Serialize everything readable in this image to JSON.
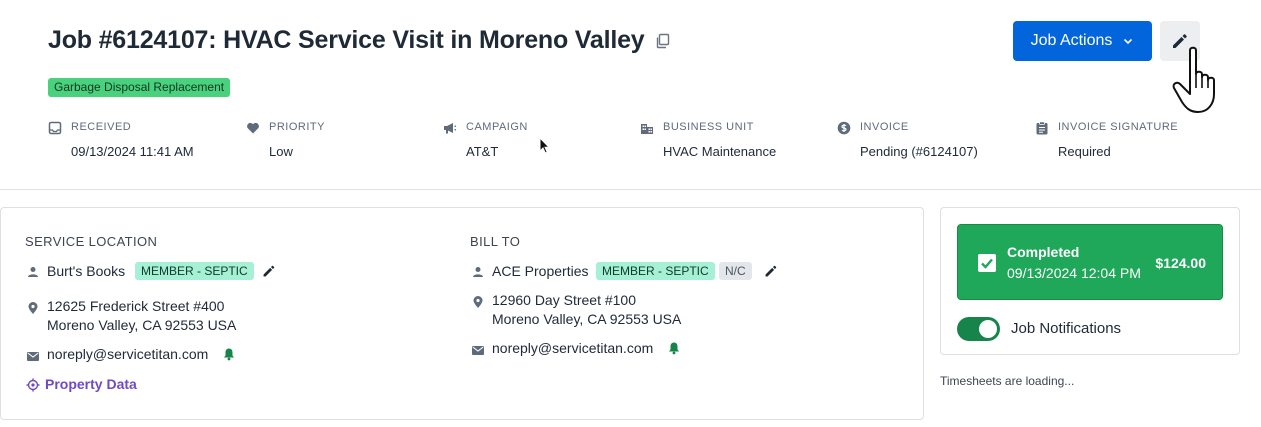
{
  "job": {
    "title": "Job #6124107: HVAC Service Visit in Moreno Valley",
    "tag": "Garbage Disposal Replacement",
    "actions_label": "Job Actions"
  },
  "meta": {
    "received": {
      "label": "RECEIVED",
      "value": "09/13/2024 11:41 AM",
      "icon": "inbox-icon"
    },
    "priority": {
      "label": "PRIORITY",
      "value": "Low",
      "icon": "heart-icon"
    },
    "campaign": {
      "label": "CAMPAIGN",
      "value": "AT&T",
      "icon": "megaphone-icon"
    },
    "business_unit": {
      "label": "BUSINESS UNIT",
      "value": "HVAC Maintenance",
      "icon": "building-icon"
    },
    "invoice": {
      "label": "INVOICE",
      "value": "Pending (#6124107)",
      "icon": "dollar-icon"
    },
    "invoice_signature": {
      "label": "INVOICE SIGNATURE",
      "value": "Required",
      "icon": "clipboard-icon"
    }
  },
  "service_location": {
    "title": "SERVICE LOCATION",
    "name": "Burt's Books",
    "badge": "MEMBER - SEPTIC",
    "address_line1": "12625 Frederick Street #400",
    "address_line2": "Moreno Valley, CA 92553 USA",
    "email": "noreply@servicetitan.com",
    "property_link": "Property Data"
  },
  "bill_to": {
    "title": "BILL TO",
    "name": "ACE Properties",
    "badge": "MEMBER - SEPTIC",
    "badge2": "N/C",
    "address_line1": "12960 Day Street #100",
    "address_line2": "Moreno Valley, CA 92553 USA",
    "email": "noreply@servicetitan.com"
  },
  "status": {
    "label": "Completed",
    "date": "09/13/2024 12:04 PM",
    "amount": "$124.00"
  },
  "notifications": {
    "label": "Job Notifications",
    "enabled": true
  },
  "timesheets": {
    "loading_text": "Timesheets are loading..."
  },
  "colors": {
    "primary": "#0265dc",
    "success": "#1fa85a",
    "tag_green": "#49d17e",
    "badge_teal": "#a6f0d6",
    "bell_green": "#17854b",
    "link_purple": "#6d4bc4"
  }
}
